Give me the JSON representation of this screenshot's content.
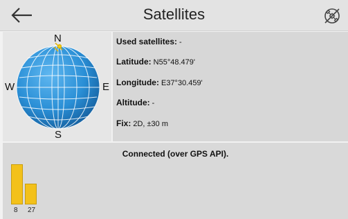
{
  "header": {
    "title": "Satellites",
    "back_icon": "arrow-left-icon",
    "satellite_icon": "satellite-off-icon"
  },
  "compass": {
    "north": "N",
    "south": "S",
    "east": "E",
    "west": "W",
    "globe_color": "#2a8fd6"
  },
  "info": {
    "used_satellites": {
      "label": "Used satellites:",
      "value": "-"
    },
    "latitude": {
      "label": "Latitude:",
      "value": "N55°48.479'"
    },
    "longitude": {
      "label": "Longitude:",
      "value": "E37°30.459'"
    },
    "altitude": {
      "label": "Altitude:",
      "value": "-"
    },
    "fix": {
      "label": "Fix:",
      "value": "2D, ±30 m"
    }
  },
  "status": {
    "text": "Connected (over GPS API)."
  },
  "signal_bars": [
    {
      "id": "8",
      "strength": 0.81,
      "color": "#f3c11a"
    },
    {
      "id": "27",
      "strength": 0.41,
      "color": "#f3c11a"
    }
  ]
}
